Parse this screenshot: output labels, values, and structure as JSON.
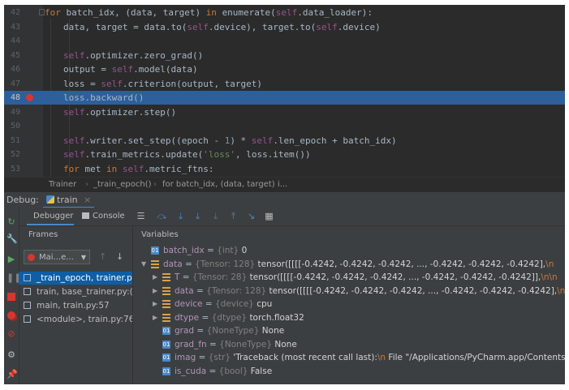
{
  "editor": {
    "lines": [
      {
        "n": "42",
        "indent": 2,
        "tokens": [
          {
            "t": "for ",
            "c": "kw"
          },
          {
            "t": "batch_idx, (data, target) ",
            "c": ""
          },
          {
            "t": "in ",
            "c": "kw"
          },
          {
            "t": "enumerate(",
            "c": ""
          },
          {
            "t": "self",
            "c": "slf"
          },
          {
            "t": ".data_loader):",
            "c": ""
          }
        ]
      },
      {
        "n": "43",
        "indent": 3,
        "tokens": [
          {
            "t": "data, target = data.to(",
            "c": ""
          },
          {
            "t": "self",
            "c": "slf"
          },
          {
            "t": ".device), target.to(",
            "c": ""
          },
          {
            "t": "self",
            "c": "slf"
          },
          {
            "t": ".device)",
            "c": ""
          }
        ]
      },
      {
        "n": "44",
        "indent": 3,
        "tokens": []
      },
      {
        "n": "45",
        "indent": 3,
        "tokens": [
          {
            "t": "self",
            "c": "slf"
          },
          {
            "t": ".optimizer.zero_grad()",
            "c": ""
          }
        ]
      },
      {
        "n": "46",
        "indent": 3,
        "tokens": [
          {
            "t": "output = ",
            "c": ""
          },
          {
            "t": "self",
            "c": "slf"
          },
          {
            "t": ".model(data)",
            "c": ""
          }
        ]
      },
      {
        "n": "47",
        "indent": 3,
        "tokens": [
          {
            "t": "loss = ",
            "c": ""
          },
          {
            "t": "self",
            "c": "slf"
          },
          {
            "t": ".criterion(output, target)",
            "c": ""
          }
        ]
      },
      {
        "n": "48",
        "indent": 3,
        "current": true,
        "breakpoint": true,
        "tokens": [
          {
            "t": "loss.backward()",
            "c": ""
          }
        ]
      },
      {
        "n": "49",
        "indent": 3,
        "tokens": [
          {
            "t": "self",
            "c": "slf"
          },
          {
            "t": ".optimizer.step()",
            "c": ""
          }
        ]
      },
      {
        "n": "50",
        "indent": 3,
        "tokens": []
      },
      {
        "n": "51",
        "indent": 3,
        "tokens": [
          {
            "t": "self",
            "c": "slf"
          },
          {
            "t": ".writer.set_step((epoch - ",
            "c": ""
          },
          {
            "t": "1",
            "c": "num"
          },
          {
            "t": ") * ",
            "c": ""
          },
          {
            "t": "self",
            "c": "slf"
          },
          {
            "t": ".len_epoch + batch_idx)",
            "c": ""
          }
        ]
      },
      {
        "n": "52",
        "indent": 3,
        "tokens": [
          {
            "t": "self",
            "c": "slf"
          },
          {
            "t": ".train_metrics.update(",
            "c": ""
          },
          {
            "t": "'loss'",
            "c": "str"
          },
          {
            "t": ", loss.item())",
            "c": ""
          }
        ]
      },
      {
        "n": "53",
        "indent": 3,
        "tokens": [
          {
            "t": "for ",
            "c": "kw"
          },
          {
            "t": "met ",
            "c": ""
          },
          {
            "t": "in ",
            "c": "kw"
          },
          {
            "t": "self",
            "c": "slf"
          },
          {
            "t": ".metric_ftns:",
            "c": ""
          }
        ]
      }
    ]
  },
  "breadcrumb": {
    "items": [
      "Trainer",
      "_train_epoch()",
      "for batch_idx, (data, target) i..."
    ],
    "separator": "›"
  },
  "debug": {
    "label": "Debug:",
    "config_tab": "train",
    "close": "×",
    "tabs": {
      "debugger": "Debugger",
      "console": "Console"
    },
    "frames_header": "Frames",
    "variables_header": "Variables",
    "thread": "Mai...e...",
    "frames": [
      {
        "label": "_train_epoch, trainer.p",
        "selected": true
      },
      {
        "label": "train, base_trainer.py:("
      },
      {
        "label": "main, train.py:57"
      },
      {
        "label": "<module>, train.py:76"
      }
    ],
    "variables": [
      {
        "depth": 0,
        "expand": "",
        "icon": "prim",
        "name": "batch_idx",
        "type": "{int}",
        "value": "0"
      },
      {
        "depth": 0,
        "expand": "open",
        "icon": "list",
        "name": "data",
        "type": "{Tensor: 128}",
        "value": "tensor([[[[-0.4242, -0.4242, -0.4242,  ..., -0.4242, -0.4242, -0.4242],",
        "tail": "\\n"
      },
      {
        "depth": 1,
        "expand": "closed",
        "icon": "list",
        "name": "T",
        "type": "{Tensor: 28}",
        "value": "tensor([[[[-0.4242, -0.4242, -0.4242,  ..., -0.4242, -0.4242, -0.4242]],",
        "tail": "\\n\\n"
      },
      {
        "depth": 1,
        "expand": "closed",
        "icon": "list",
        "name": "data",
        "type": "{Tensor: 128}",
        "value": "tensor([[[[-0.4242, -0.4242, -0.4242,  ..., -0.4242, -0.4242, -0.4242],",
        "tail": "\\n"
      },
      {
        "depth": 1,
        "expand": "closed",
        "icon": "list",
        "name": "device",
        "type": "{device}",
        "value": "cpu"
      },
      {
        "depth": 1,
        "expand": "closed",
        "icon": "list",
        "name": "dtype",
        "type": "{dtype}",
        "value": "torch.float32"
      },
      {
        "depth": 1,
        "expand": "",
        "icon": "prim",
        "name": "grad",
        "type": "{NoneType}",
        "value": "None"
      },
      {
        "depth": 1,
        "expand": "",
        "icon": "prim",
        "name": "grad_fn",
        "type": "{NoneType}",
        "value": "None"
      },
      {
        "depth": 1,
        "expand": "",
        "icon": "prim",
        "name": "imag",
        "type": "{str}",
        "value": "'Traceback (most recent call last):",
        "tail": "\\n",
        "extra": "  File \"/Applications/PyCharm.app/Contents/plu"
      },
      {
        "depth": 1,
        "expand": "",
        "icon": "prim",
        "name": "is_cuda",
        "type": "{bool}",
        "value": "False"
      }
    ]
  },
  "colors": {
    "accent": "#4a88c7",
    "breakpoint": "#d9352f",
    "current_line": "#2d5f9a",
    "selection": "#0d5ea6"
  },
  "icons": {
    "toolbar": [
      "menu-icon",
      "step-over-icon",
      "step-into-icon",
      "step-into-my-code-icon",
      "force-step-into-icon",
      "step-out-icon",
      "run-to-cursor-icon",
      "evaluate-expression-icon"
    ],
    "side": [
      "rerun-icon",
      "wrench-icon",
      "resume-icon",
      "pause-icon",
      "stop-icon",
      "view-breakpoints-icon",
      "mute-breakpoints-icon",
      "settings-icon",
      "pin-icon"
    ]
  }
}
